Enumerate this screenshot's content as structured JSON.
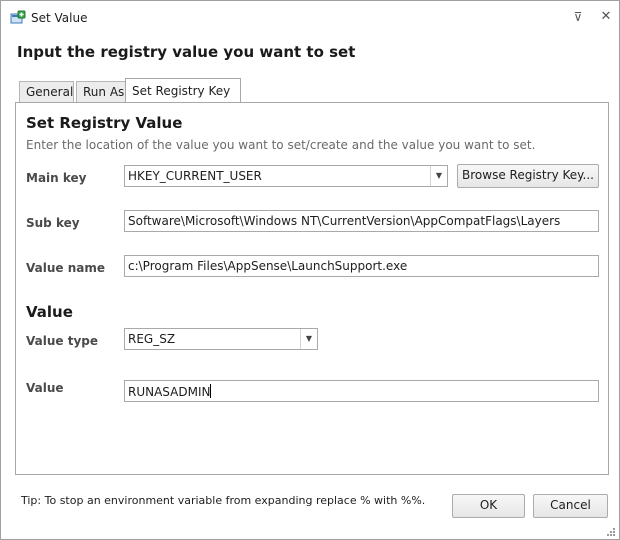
{
  "window": {
    "title": "Set Value",
    "pin_glyph": "⊽",
    "close_glyph": "✕"
  },
  "heading": "Input the registry value you want to set",
  "tabs": [
    {
      "label": "General"
    },
    {
      "label": "Run As"
    },
    {
      "label": "Set Registry Key"
    }
  ],
  "registry": {
    "title": "Set Registry Value",
    "description": "Enter the location of the value you want to set/create and the value you want to set.",
    "main_key_label": "Main key",
    "main_key_value": "HKEY_CURRENT_USER",
    "browse_label": "Browse Registry Key...",
    "sub_key_label": "Sub key",
    "sub_key_value": "Software\\Microsoft\\Windows NT\\CurrentVersion\\AppCompatFlags\\Layers",
    "value_name_label": "Value name",
    "value_name_value": "c:\\Program Files\\AppSense\\LaunchSupport.exe"
  },
  "value": {
    "title": "Value",
    "type_label": "Value type",
    "type_value": "REG_SZ",
    "value_label": "Value",
    "value_value": "RUNASADMIN"
  },
  "footer": {
    "tip": "Tip: To stop an environment variable from expanding replace % with %%.",
    "ok_label": "OK",
    "cancel_label": "Cancel"
  },
  "colors": {
    "panel_border": "#a8a8a8",
    "label_text": "#4a4a4a",
    "desc_text": "#6a6a6a"
  },
  "icons": {
    "app": "registry-set-icon",
    "dropdown": "chevron-down-icon"
  }
}
